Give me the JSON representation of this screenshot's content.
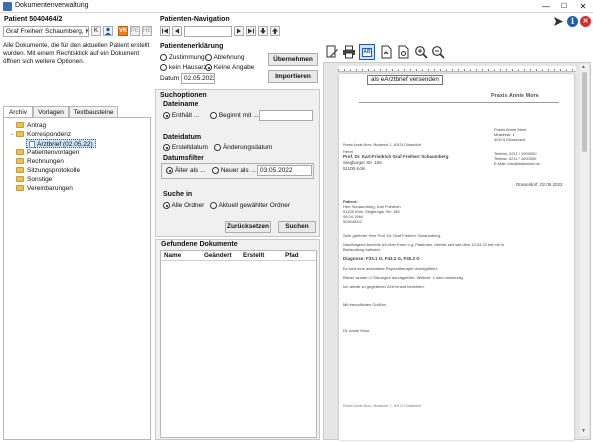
{
  "window": {
    "title": "Dokumentenverwaltung",
    "minimize": "—",
    "maximize": "☐",
    "close": "✕"
  },
  "patient": {
    "label": "Patient 5040464/2",
    "name": "Graf Freiherr Schaumberg, Karl-",
    "k_label": "K",
    "vk_label": "VK",
    "pe_label": "PE",
    "he_label": "HE"
  },
  "nav": {
    "label": "Patienten-Navigation",
    "first": "|◀",
    "prev": "◀",
    "next": "▶",
    "last": "▶|"
  },
  "top_right": {
    "send": "⮞",
    "info": "i",
    "close": "✕"
  },
  "info_text": "Alle Dokumente, die für den aktuellen Patient erstellt wurden. Mit einem Rechtsklick auf ein Dokument öffnen sich weitere Optionen.",
  "left_tabs": [
    "Archiv",
    "Vorlagen",
    "Textbausteine"
  ],
  "tree": [
    {
      "label": "Antrag",
      "level": 1,
      "toggle": ""
    },
    {
      "label": "Korrespondenz",
      "level": 1,
      "toggle": "−"
    },
    {
      "label": "Arztbrief (02.05.22)",
      "level": 2,
      "toggle": ""
    },
    {
      "label": "Patientenvorlagen",
      "level": 1,
      "toggle": ""
    },
    {
      "label": "Rechnungen",
      "level": 1,
      "toggle": ""
    },
    {
      "label": "Sitzungsprotokolle",
      "level": 1,
      "toggle": ""
    },
    {
      "label": "Sonstige",
      "level": 1,
      "toggle": ""
    },
    {
      "label": "Vereinbarungen",
      "level": 1,
      "toggle": ""
    }
  ],
  "consent": {
    "title": "Patientenerklärung",
    "options": [
      "Zustimmung",
      "Ablehnung",
      "kein Hausarzt",
      "Keine Angabe"
    ],
    "date_label": "Datum",
    "date_value": "02.05.2022",
    "save_button": "Übernehmen",
    "import_button": "Importieren"
  },
  "search": {
    "title": "Suchoptionen",
    "filename_title": "Dateiname",
    "filename_options": [
      "Enthält ...",
      "Beginnt mit ..."
    ],
    "filename_value": "",
    "filedate_title": "Dateidatum",
    "filedate_options": [
      "Erstelldatum",
      "Änderungsdatum"
    ],
    "datefilter_title": "Datumsfilter",
    "datefilter_options": [
      "Älter als ...",
      "Neuer als ..."
    ],
    "datefilter_value": "03.05.2022",
    "searchin_title": "Suche in",
    "searchin_options": [
      "Alle Ordner",
      "Aktuell gewählter Ordner"
    ],
    "reset_button": "Zurücksetzen",
    "search_button": "Suchen"
  },
  "found": {
    "title": "Gefundene Dokumente",
    "columns": [
      "Name",
      "Geändert",
      "Erstellt",
      "Pfad"
    ]
  },
  "viewer": {
    "tooltip": "als eArztbrief versenden",
    "icons": [
      "edit-icon",
      "print-icon",
      "ab-icon",
      "pdf-icon",
      "export-icon",
      "zoom-in-icon",
      "zoom-out-icon"
    ],
    "ab_label": "AB"
  },
  "letter": {
    "header": "Praxis Annie More",
    "sender_line": "Praxis Annie More, Musterstr. 1, 40474 Düsseldorf",
    "recipient": [
      "Herrn",
      "Prof. Dr. Karl-Friedrich Graf Freiherr Schaumberg",
      "Siegburger Str. 155",
      "51105 Köln"
    ],
    "sender_block": [
      "Praxis Annie More",
      "Musterstr. 1",
      "40474 Düsseldorf"
    ],
    "contact": [
      "Telefon:   0211 / 1000000",
      "Telefax:   0211 / 1000000",
      "E-Mail:    info@testannie.de"
    ],
    "date_line": "Düsseldorf, 02.05.2022",
    "patient_block": [
      "Patient:",
      "Herr Schaumberg, Karl Friedrich",
      "51105 Köln, Siegburger Str. 155",
      "06.04.1964",
      "5040464/2"
    ],
    "salutation": "Sehr geehrter Herr Prof. Dr. Graf Freiherr Schaumberg,",
    "body1a": "Nachfolgend berichte ich über Ihren o.g. Patienten, der/die seit seit dem 15.03.22 bei mir in",
    "body1b": "Behandlung befindet.",
    "diagnosis": "Diagnose: F33.1 G, F43.2 G, F40.2 G",
    "body2": "Es wird eine ambulante Psychotherapie durchgeführt.",
    "body3": "Bisher wurden 2 Sitzungen durchgeführt. Weitere -1 sind notwendig.",
    "body4": "Ich werde zu gegebener Zeit erneut berichten.",
    "closing": "Mit freundlichen Grüßen",
    "signature": "Dr. Annie More",
    "footer": "Praxis Annie More, Musterstr. 1, 40474 Düsseldorf"
  },
  "colors": {
    "accent": "#1a5fb4",
    "vk_badge": "#f07b16",
    "selection": "#cce4f7",
    "panel": "#f0f0f0"
  }
}
